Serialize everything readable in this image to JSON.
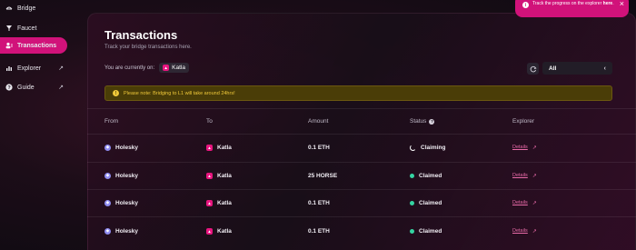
{
  "sidebar": {
    "items": [
      {
        "label": "Bridge",
        "icon": "bridge-icon",
        "active": false,
        "external": false
      },
      {
        "label": "Faucet",
        "icon": "faucet-icon",
        "active": false,
        "external": false
      },
      {
        "label": "Transactions",
        "icon": "transactions-icon",
        "active": true,
        "external": false
      },
      {
        "label": "Explorer",
        "icon": "explorer-icon",
        "active": false,
        "external": true
      },
      {
        "label": "Guide",
        "icon": "guide-icon",
        "active": false,
        "external": true
      }
    ]
  },
  "main": {
    "title": "Transactions",
    "subtitle": "Track your bridge transactions here.",
    "current_label": "You are currently on:",
    "current_chain": "Katla",
    "filter_value": "All",
    "note": "Please note: Bridging to L1 will take around 24hrs!",
    "table": {
      "headers": [
        "From",
        "To",
        "Amount",
        "Status",
        "Explorer"
      ],
      "rows": [
        {
          "from": "Holesky",
          "to": "Katla",
          "amount": "0.1 ETH",
          "status": "Claiming",
          "explorer": "Details"
        },
        {
          "from": "Holesky",
          "to": "Katla",
          "amount": "25 HORSE",
          "status": "Claimed",
          "explorer": "Details"
        },
        {
          "from": "Holesky",
          "to": "Katla",
          "amount": "0.1 ETH",
          "status": "Claimed",
          "explorer": "Details"
        },
        {
          "from": "Holesky",
          "to": "Katla",
          "amount": "0.1 ETH",
          "status": "Claimed",
          "explorer": "Details"
        }
      ]
    }
  },
  "toast": {
    "text_prefix": "Track the progress on the explorer",
    "link": "here",
    "suffix": "."
  },
  "colors": {
    "accent": "#d1127a",
    "claimed": "#35d4a2",
    "warning_bg": "#4a3d07",
    "warning_text": "#f0c93a"
  }
}
